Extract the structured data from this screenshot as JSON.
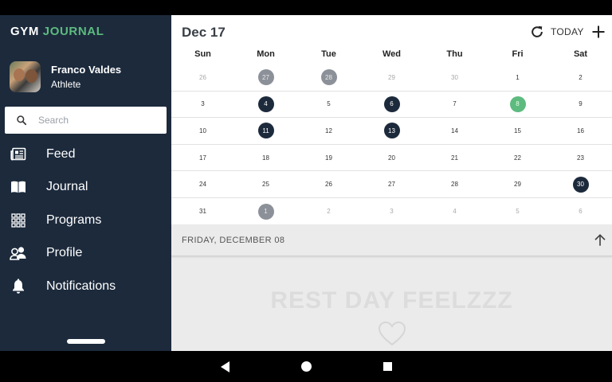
{
  "app": {
    "brand_word1": "GYM",
    "brand_word2": "JOURNAL",
    "brand_color": "#5dbb7f",
    "sidebar_color": "#1c2a3c"
  },
  "user": {
    "name": "Franco Valdes",
    "role": "Athlete"
  },
  "search": {
    "placeholder": "Search",
    "value": ""
  },
  "menu": [
    {
      "label": "Feed",
      "icon": "newspaper-icon"
    },
    {
      "label": "Journal",
      "icon": "book-icon"
    },
    {
      "label": "Programs",
      "icon": "grid-icon"
    },
    {
      "label": "Profile",
      "icon": "people-icon"
    },
    {
      "label": "Notifications",
      "icon": "bell-icon"
    }
  ],
  "calendar": {
    "month_label": "Dec 17",
    "today_label": "TODAY",
    "weekdays": [
      "Sun",
      "Mon",
      "Tue",
      "Wed",
      "Thu",
      "Fri",
      "Sat"
    ],
    "weeks": [
      [
        {
          "d": "26",
          "s": "muted"
        },
        {
          "d": "27",
          "s": "gray"
        },
        {
          "d": "28",
          "s": "gray"
        },
        {
          "d": "29",
          "s": "muted"
        },
        {
          "d": "30",
          "s": "muted"
        },
        {
          "d": "1",
          "s": ""
        },
        {
          "d": "2",
          "s": ""
        }
      ],
      [
        {
          "d": "3",
          "s": ""
        },
        {
          "d": "4",
          "s": "dark"
        },
        {
          "d": "5",
          "s": ""
        },
        {
          "d": "6",
          "s": "dark"
        },
        {
          "d": "7",
          "s": ""
        },
        {
          "d": "8",
          "s": "green"
        },
        {
          "d": "9",
          "s": ""
        }
      ],
      [
        {
          "d": "10",
          "s": ""
        },
        {
          "d": "11",
          "s": "dark"
        },
        {
          "d": "12",
          "s": ""
        },
        {
          "d": "13",
          "s": "dark"
        },
        {
          "d": "14",
          "s": ""
        },
        {
          "d": "15",
          "s": ""
        },
        {
          "d": "16",
          "s": ""
        }
      ],
      [
        {
          "d": "17",
          "s": ""
        },
        {
          "d": "18",
          "s": ""
        },
        {
          "d": "19",
          "s": ""
        },
        {
          "d": "20",
          "s": ""
        },
        {
          "d": "21",
          "s": ""
        },
        {
          "d": "22",
          "s": ""
        },
        {
          "d": "23",
          "s": ""
        }
      ],
      [
        {
          "d": "24",
          "s": ""
        },
        {
          "d": "25",
          "s": ""
        },
        {
          "d": "26",
          "s": ""
        },
        {
          "d": "27",
          "s": ""
        },
        {
          "d": "28",
          "s": ""
        },
        {
          "d": "29",
          "s": ""
        },
        {
          "d": "30",
          "s": "dark"
        }
      ],
      [
        {
          "d": "31",
          "s": ""
        },
        {
          "d": "1",
          "s": "gray"
        },
        {
          "d": "2",
          "s": "muted"
        },
        {
          "d": "3",
          "s": "muted"
        },
        {
          "d": "4",
          "s": "muted"
        },
        {
          "d": "5",
          "s": "muted"
        },
        {
          "d": "6",
          "s": "muted"
        }
      ]
    ]
  },
  "detail": {
    "date_label": "FRIDAY, DECEMBER 08",
    "message": "REST DAY FEELZZZ"
  }
}
